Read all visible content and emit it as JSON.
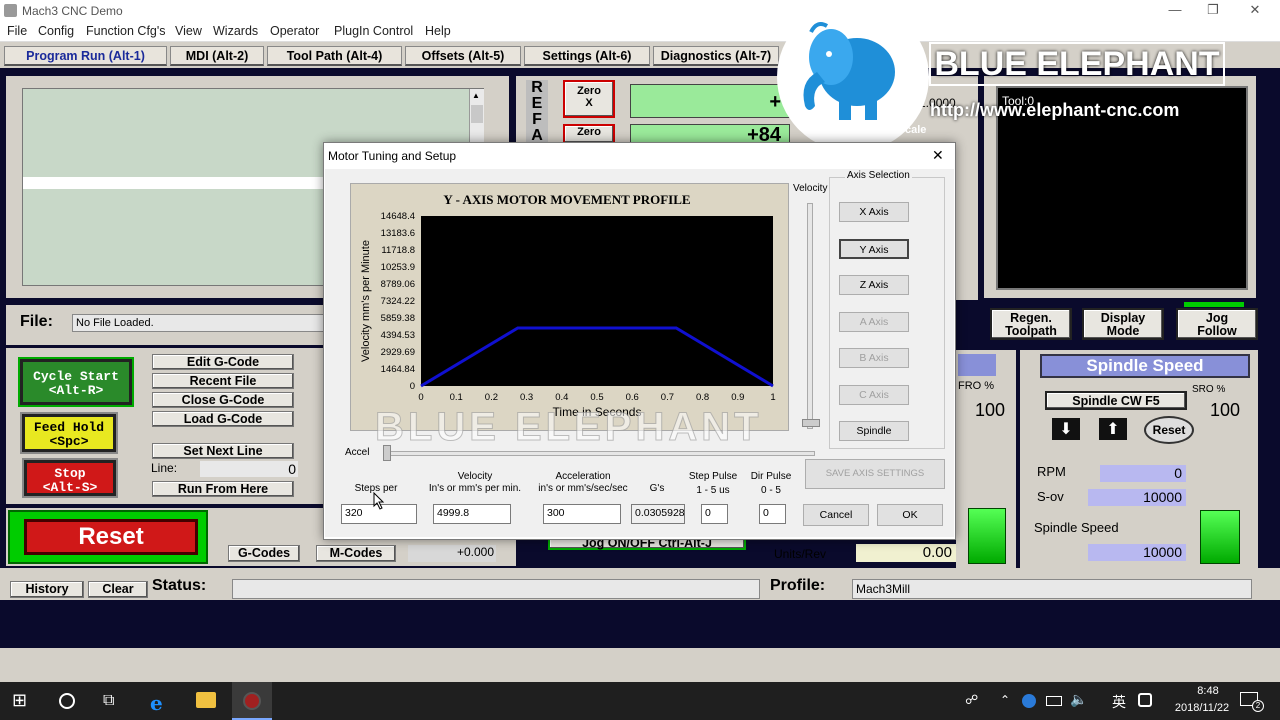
{
  "window": {
    "title": "Mach3 CNC  Demo"
  },
  "menu": [
    "File",
    "Config",
    "Function Cfg's",
    "View",
    "Wizards",
    "Operator",
    "PlugIn Control",
    "Help"
  ],
  "tabs": [
    "Program Run (Alt-1)",
    "MDI (Alt-2)",
    "Tool Path (Alt-4)",
    "Offsets (Alt-5)",
    "Settings (Alt-6)",
    "Diagnostics (Alt-7)"
  ],
  "dro": {
    "ref_letters": [
      "R",
      "E",
      "F",
      "A"
    ],
    "zero_x": "Zero\nX",
    "zero_x2": "Zero",
    "x_value": "+",
    "y_value": "+84",
    "right_value": "+1.0000",
    "scale_label": "cale",
    "tool_label": "Tool:0"
  },
  "file": {
    "label": "File:",
    "value": "No File Loaded."
  },
  "gcode_buttons": [
    "Edit G-Code",
    "Recent File",
    "Close G-Code",
    "Load G-Code"
  ],
  "set_next_line": "Set Next Line",
  "line_label": "Line:",
  "line_value": "0",
  "run_from_here": "Run From Here",
  "cycle_start": "Cycle Start\n<Alt-R>",
  "feed_hold": "Feed Hold\n<Spc>",
  "stop": "Stop\n<Alt-S>",
  "reset": "Reset",
  "gcodes_btn": "G-Codes",
  "mcodes_btn": "M-Codes",
  "inhibit_value": "+0.000",
  "jog_onoff": "Jog ON/OFF Ctrl-Alt-J",
  "toolpath_buttons": [
    "Regen.\nToolpath",
    "Display\nMode",
    "Jog\nFollow"
  ],
  "feed": {
    "fro_label": "FRO %",
    "fro_value": "100",
    "units_rev_label": "Units/Rev",
    "units_rev_value": "0.00"
  },
  "spindle": {
    "title": "Spindle Speed",
    "cw_button": "Spindle CW F5",
    "sro_label": "SRO %",
    "sro_value": "100",
    "reset": "Reset",
    "rpm_label": "RPM",
    "rpm_value": "0",
    "sov_label": "S-ov",
    "sov_value": "10000",
    "speed_label": "Spindle Speed",
    "speed_value": "10000"
  },
  "status_bar": {
    "history": "History",
    "clear": "Clear",
    "status_label": "Status:",
    "profile_label": "Profile:",
    "profile_value": "Mach3Mill"
  },
  "watermark": {
    "brand": "BLUE ELEPHANT",
    "url": "http://www.elephant-cnc.com",
    "chart_watermark": "BLUE ELEPHANT"
  },
  "dialog": {
    "title": "Motor Tuning and Setup",
    "close": "✕",
    "velocity_label": "Velocity",
    "accel_label": "Accel",
    "axis_group": "Axis Selection",
    "axes": [
      {
        "label": "X Axis",
        "enabled": true
      },
      {
        "label": "Y Axis",
        "enabled": true
      },
      {
        "label": "Z Axis",
        "enabled": true
      },
      {
        "label": "A Axis",
        "enabled": false
      },
      {
        "label": "B Axis",
        "enabled": false
      },
      {
        "label": "C Axis",
        "enabled": false
      },
      {
        "label": "Spindle",
        "enabled": true
      }
    ],
    "fields": {
      "steps_label": "Steps per",
      "steps_value": "320",
      "velocity_h1": "Velocity",
      "velocity_h2": "In's or mm's per min.",
      "velocity_value": "4999.8",
      "accel_h1": "Acceleration",
      "accel_h2": "in's or mm's/sec/sec",
      "accel_value": "300",
      "gs_label": "G's",
      "gs_value": "0.0305928",
      "step_pulse_h1": "Step Pulse",
      "step_pulse_h2": "1 - 5 us",
      "step_pulse_value": "0",
      "dir_pulse_h1": "Dir Pulse",
      "dir_pulse_h2": "0 - 5",
      "dir_pulse_value": "0"
    },
    "save_button": "SAVE AXIS SETTINGS",
    "cancel": "Cancel",
    "ok": "OK"
  },
  "chart_data": {
    "type": "line",
    "title": "Y - AXIS MOTOR MOVEMENT PROFILE",
    "xlabel": "Time in Seconds",
    "ylabel": "Velocity mm's per Minute",
    "xlim": [
      0,
      1
    ],
    "ylim": [
      0,
      14648.4
    ],
    "x_ticks": [
      "0",
      "0.1",
      "0.2",
      "0.3",
      "0.4",
      "0.5",
      "0.6",
      "0.7",
      "0.8",
      "0.9",
      "1"
    ],
    "y_ticks": [
      "0",
      "1464.84",
      "2929.69",
      "4394.53",
      "5859.38",
      "7324.22",
      "8789.06",
      "10253.9",
      "11718.8",
      "13183.6",
      "14648.4"
    ],
    "series": [
      {
        "color": "#1010d0",
        "x": [
          0,
          0.275,
          0.725,
          1.0
        ],
        "y": [
          0,
          4999.8,
          4999.8,
          0
        ]
      }
    ],
    "grid": false,
    "background": "#000000"
  },
  "taskbar": {
    "time": "8:48",
    "date": "2018/11/22",
    "ime": "英",
    "notif_count": "2"
  },
  "colors": {
    "accent_blue": "#1a2a9a",
    "dro_green": "#9aea9a",
    "reset_red": "#d01818",
    "feed_yellow": "#e8e820"
  }
}
